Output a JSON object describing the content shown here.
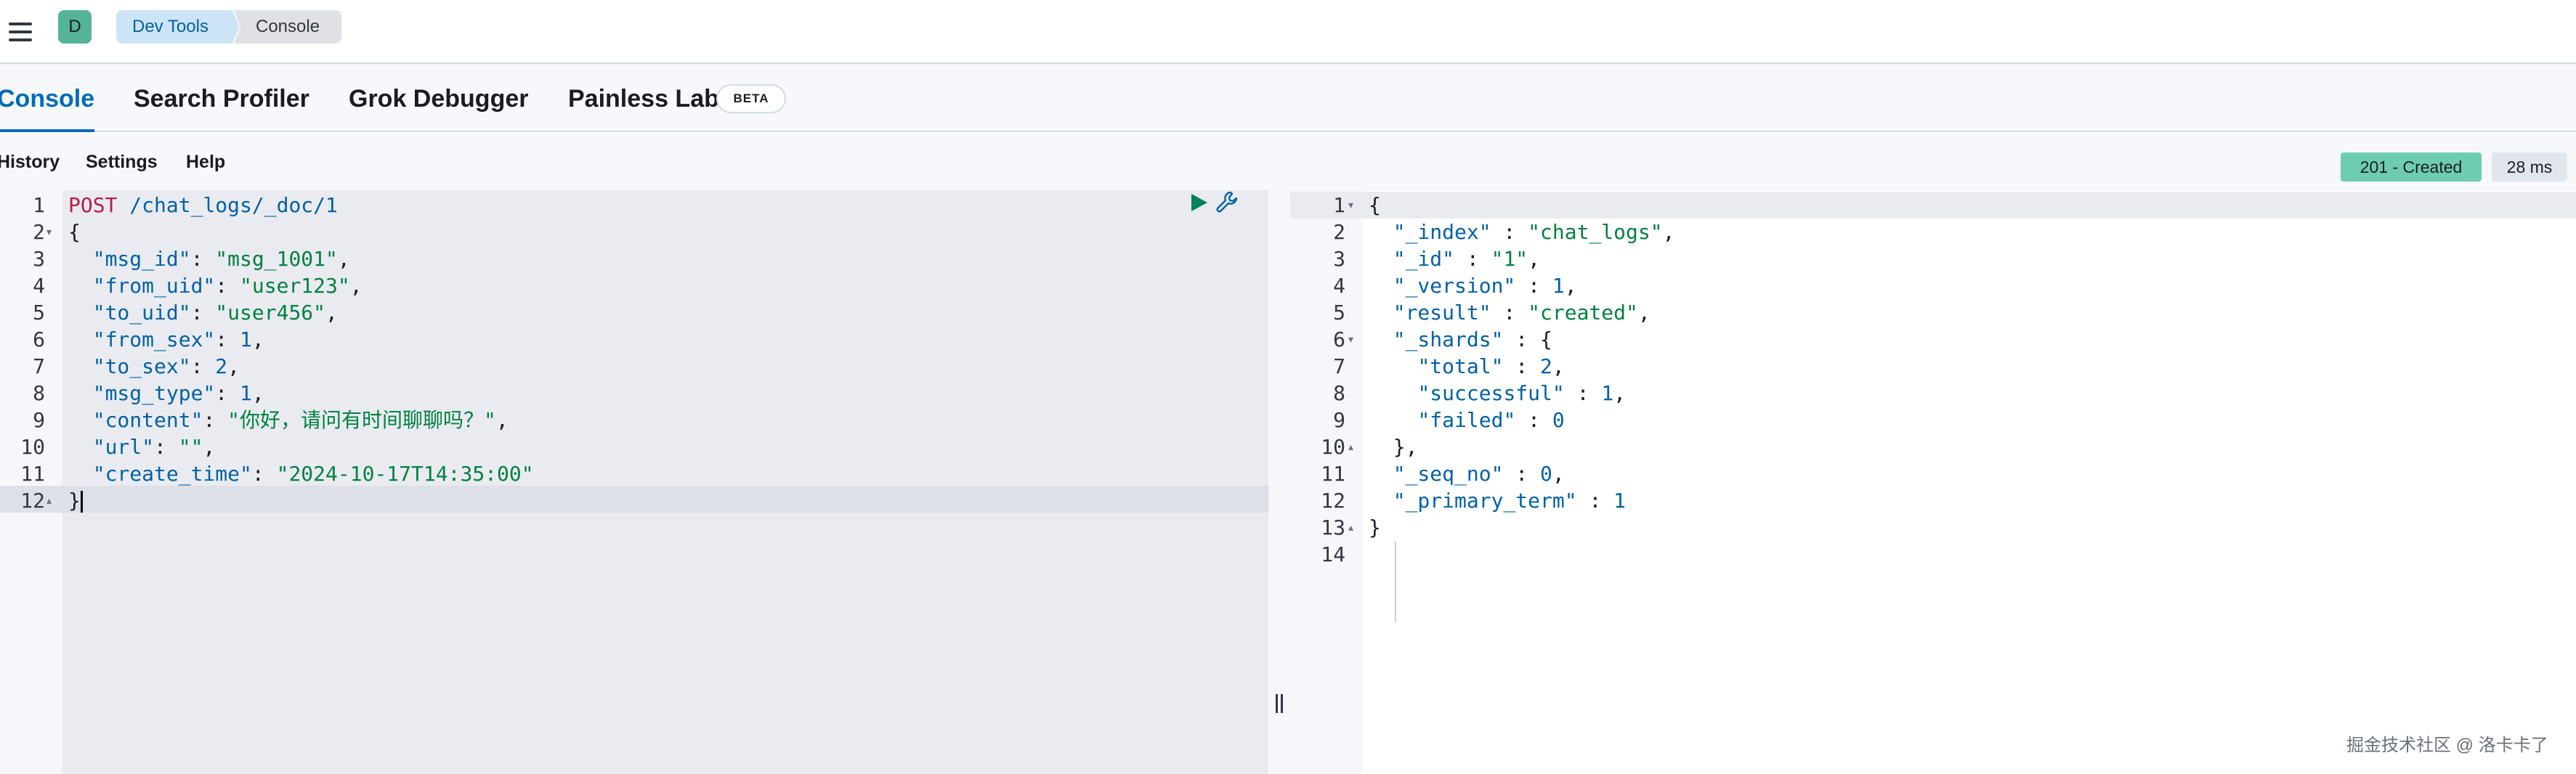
{
  "header": {
    "avatar_letter": "D",
    "breadcrumbs": [
      "Dev Tools",
      "Console"
    ]
  },
  "tabs": [
    {
      "label": "Console",
      "active": true
    },
    {
      "label": "Search Profiler",
      "active": false
    },
    {
      "label": "Grok Debugger",
      "active": false
    },
    {
      "label": "Painless Lab",
      "active": false
    }
  ],
  "beta_badge": "BETA",
  "toolbar": {
    "history": "History",
    "settings": "Settings",
    "help": "Help"
  },
  "response_status": {
    "status": "201 - Created",
    "time": "28 ms",
    "status_color": "#6dccb1"
  },
  "request_editor": {
    "lines": [
      {
        "num": "1",
        "text": "POST /chat_logs/_doc/1"
      },
      {
        "num": "2",
        "text": "{"
      },
      {
        "num": "3",
        "text": "  \"msg_id\": \"msg_1001\","
      },
      {
        "num": "4",
        "text": "  \"from_uid\": \"user123\","
      },
      {
        "num": "5",
        "text": "  \"to_uid\": \"user456\","
      },
      {
        "num": "6",
        "text": "  \"from_sex\": 1,"
      },
      {
        "num": "7",
        "text": "  \"to_sex\": 2,"
      },
      {
        "num": "8",
        "text": "  \"msg_type\": 1,"
      },
      {
        "num": "9",
        "text": "  \"content\": \"你好，请问有时间聊聊吗？\","
      },
      {
        "num": "10",
        "text": "  \"url\": \"\","
      },
      {
        "num": "11",
        "text": "  \"create_time\": \"2024-10-17T14:35:00\""
      },
      {
        "num": "12",
        "text": "}"
      }
    ]
  },
  "response_editor": {
    "lines": [
      {
        "num": "1",
        "text": "{"
      },
      {
        "num": "2",
        "text": "  \"_index\" : \"chat_logs\","
      },
      {
        "num": "3",
        "text": "  \"_id\" : \"1\","
      },
      {
        "num": "4",
        "text": "  \"_version\" : 1,"
      },
      {
        "num": "5",
        "text": "  \"result\" : \"created\","
      },
      {
        "num": "6",
        "text": "  \"_shards\" : {"
      },
      {
        "num": "7",
        "text": "    \"total\" : 2,"
      },
      {
        "num": "8",
        "text": "    \"successful\" : 1,"
      },
      {
        "num": "9",
        "text": "    \"failed\" : 0"
      },
      {
        "num": "10",
        "text": "  },"
      },
      {
        "num": "11",
        "text": "  \"_seq_no\" : 0,"
      },
      {
        "num": "12",
        "text": "  \"_primary_term\" : 1"
      },
      {
        "num": "13",
        "text": "}"
      },
      {
        "num": "14",
        "text": ""
      }
    ]
  },
  "watermark": "掘金技术社区 @ 洛卡卡了",
  "icons": {
    "menu": "hamburger-menu-icon",
    "run": "play-icon",
    "actions": "wrench-icon"
  }
}
